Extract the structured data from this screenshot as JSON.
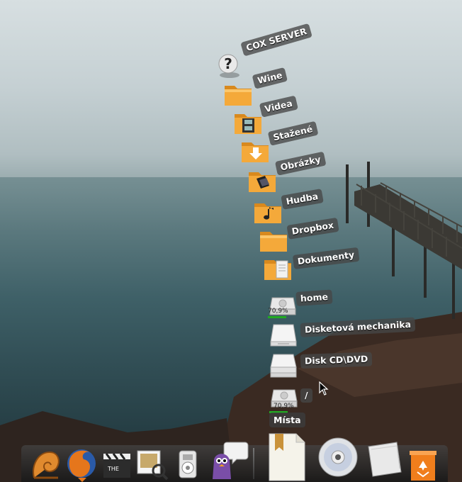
{
  "stack": {
    "title": "Místa",
    "items": [
      {
        "label": "COX SERVER",
        "icon": "question-icon"
      },
      {
        "label": "Wine",
        "icon": "folder-icon"
      },
      {
        "label": "Videa",
        "icon": "video-folder-icon"
      },
      {
        "label": "Stažené",
        "icon": "download-folder-icon"
      },
      {
        "label": "Obrázky",
        "icon": "pictures-folder-icon"
      },
      {
        "label": "Hudba",
        "icon": "music-folder-icon"
      },
      {
        "label": "Dropbox",
        "icon": "folder-icon"
      },
      {
        "label": "Dokumenty",
        "icon": "documents-folder-icon"
      },
      {
        "label": "home",
        "icon": "drive-icon",
        "usage": "70,9%"
      },
      {
        "label": "Disketová mechanika",
        "icon": "floppy-drive-icon"
      },
      {
        "label": "Disk CD\\DVD",
        "icon": "optical-drive-icon"
      },
      {
        "label": "/",
        "icon": "drive-icon",
        "usage": "70,9%"
      }
    ]
  },
  "dock": {
    "launchers": [
      "nautilus-shell-icon",
      "firefox-icon",
      "movie-clapper-icon",
      "image-viewer-icon",
      "media-player-icon",
      "pidgin-icon"
    ],
    "stacks": [
      "places-stack-icon",
      "cd-dvd-icon",
      "file-manager-icon",
      "trash-icon"
    ]
  }
}
